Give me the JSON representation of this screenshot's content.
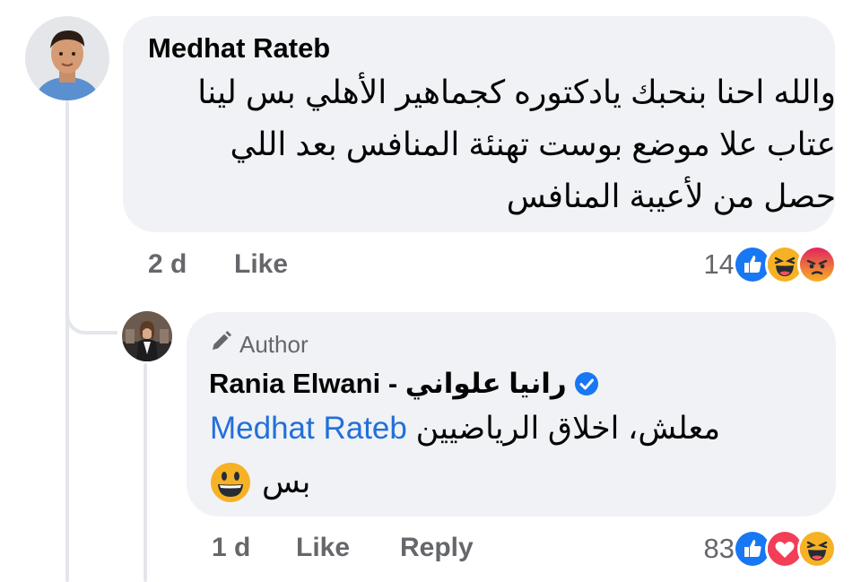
{
  "comment": {
    "author": "Medhat Rateb",
    "lines": [
      "والله احنا بنحبك يادكتوره كجماهير الأهلي بس لينا",
      "عتاب علا موضع بوست تهنئة المنافس بعد اللي",
      "حصل من لأعيبة المنافس"
    ],
    "time": "2 d",
    "like_label": "Like",
    "reaction_count": "14",
    "reactions": [
      "like-icon",
      "haha-icon",
      "angry-icon"
    ]
  },
  "reply": {
    "badge": "Author",
    "author": "Rania Elwani - رانيا علواني",
    "mention": "Medhat Rateb",
    "line1_text": "معلش، اخلاق الرياضيين",
    "line2_text": "بس",
    "emoji": "grinning-emoji",
    "time": "1 d",
    "like_label": "Like",
    "reply_label": "Reply",
    "reaction_count": "83",
    "reactions": [
      "like-icon",
      "love-icon",
      "haha-icon"
    ]
  },
  "colors": {
    "bubble": "#f0f2f5",
    "meta": "#65676b",
    "mention": "#216fdb",
    "like": "#1877f2",
    "love": "#f33e58",
    "haha": "#f7b125",
    "angry": "#e9710f"
  }
}
